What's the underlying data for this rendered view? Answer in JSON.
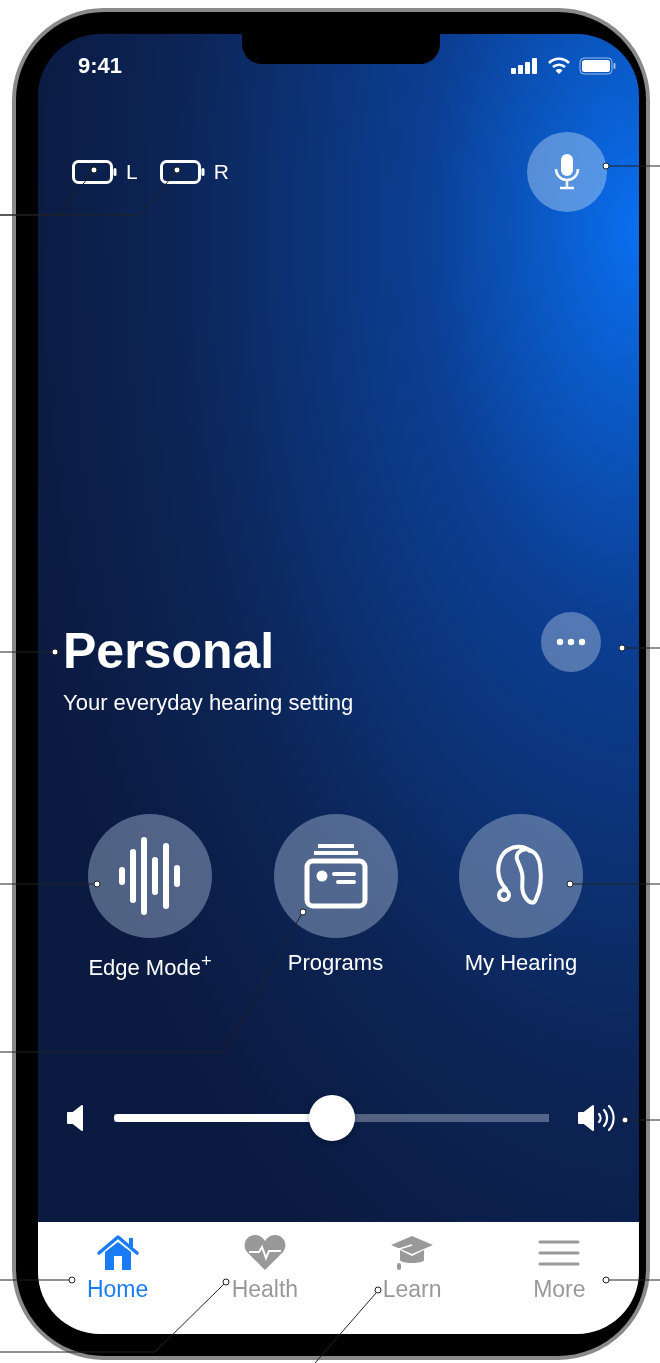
{
  "status_bar": {
    "time": "9:41"
  },
  "hearing_aids": [
    {
      "label": "L"
    },
    {
      "label": "R"
    }
  ],
  "program": {
    "title": "Personal",
    "subtitle": "Your everyday hearing setting"
  },
  "actions": [
    {
      "label": "Edge Mode$^{+}$"
    },
    {
      "label": "Programs"
    },
    {
      "label": "My Hearing"
    }
  ],
  "volume": {
    "level": 0.5
  },
  "tabs": [
    {
      "label": "Home",
      "selected": true
    },
    {
      "label": "Health",
      "selected": false
    },
    {
      "label": "Learn",
      "selected": false
    },
    {
      "label": "More",
      "selected": false
    }
  ]
}
